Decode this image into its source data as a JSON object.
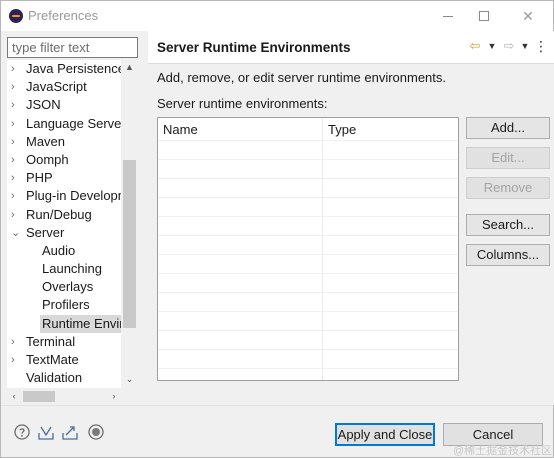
{
  "window": {
    "title": "Preferences",
    "minimize_label": "",
    "maximize_label": "",
    "close_label": "✕"
  },
  "filter": {
    "placeholder": "type filter text",
    "value": ""
  },
  "tree": {
    "items": [
      {
        "label": "Java Persistence",
        "arrow": "›"
      },
      {
        "label": "JavaScript",
        "arrow": "›"
      },
      {
        "label": "JSON",
        "arrow": "›"
      },
      {
        "label": "Language Server",
        "arrow": "›"
      },
      {
        "label": "Maven",
        "arrow": "›"
      },
      {
        "label": "Oomph",
        "arrow": "›"
      },
      {
        "label": "PHP",
        "arrow": "›"
      },
      {
        "label": "Plug-in Developm",
        "arrow": "›"
      },
      {
        "label": "Run/Debug",
        "arrow": "›"
      },
      {
        "label": "Server",
        "arrow": "⌄"
      },
      {
        "label": "Audio"
      },
      {
        "label": "Launching"
      },
      {
        "label": "Overlays"
      },
      {
        "label": "Profilers"
      },
      {
        "label": "Runtime Enviro"
      },
      {
        "label": "Terminal",
        "arrow": "›"
      },
      {
        "label": "TextMate",
        "arrow": "›"
      },
      {
        "label": "Validation"
      }
    ],
    "scroll_up": "▲",
    "scroll_down": "⌄",
    "scroll_left": "‹",
    "scroll_right": "›"
  },
  "page": {
    "title": "Server Runtime Environments",
    "description": "Add, remove, or edit server runtime environments.",
    "list_label": "Server runtime environments:",
    "nav": {
      "back": "⇦",
      "back_dropdown": "▼",
      "forward": "⇨",
      "forward_dropdown": "▼",
      "menu": "⋮"
    }
  },
  "table": {
    "columns": [
      "Name",
      "Type"
    ],
    "rows": []
  },
  "buttons": {
    "add": "Add...",
    "edit": "Edit...",
    "remove": "Remove",
    "search": "Search...",
    "columns": "Columns...",
    "apply_close": "Apply and Close",
    "cancel": "Cancel"
  },
  "watermark": "@稀土掘金技术社区",
  "colors": {
    "accent": "#0078d7",
    "disabled_text": "#a3a3a3",
    "selection": "#d9d9d9"
  }
}
